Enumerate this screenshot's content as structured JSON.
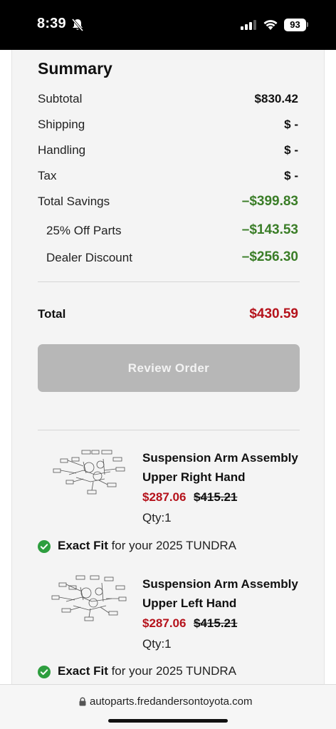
{
  "status_bar": {
    "time": "8:39",
    "battery": "93"
  },
  "summary": {
    "title": "Summary",
    "rows": [
      {
        "label": "Subtotal",
        "value": "$830.42"
      },
      {
        "label": "Shipping",
        "value": "$ -"
      },
      {
        "label": "Handling",
        "value": "$ -"
      },
      {
        "label": "Tax",
        "value": "$ -"
      },
      {
        "label": "Total Savings",
        "value": "–$399.83"
      },
      {
        "label": "25% Off Parts",
        "value": "–$143.53"
      },
      {
        "label": "Dealer Discount",
        "value": "–$256.30"
      }
    ],
    "total_label": "Total",
    "total_value": "$430.59",
    "review_button": "Review Order"
  },
  "items": [
    {
      "name_line1": "Suspension Arm Assembly",
      "name_line2": "Upper Right Hand",
      "price": "$287.06",
      "original_price": "$415.21",
      "qty": "Qty:1",
      "fit_strong": "Exact Fit",
      "fit_rest": " for your 2025 TUNDRA"
    },
    {
      "name_line1": "Suspension Arm Assembly",
      "name_line2": "Upper Left Hand",
      "price": "$287.06",
      "original_price": "$415.21",
      "qty": "Qty:1",
      "fit_strong": "Exact Fit",
      "fit_rest": " for your 2025 TUNDRA"
    }
  ],
  "browser": {
    "url": "autoparts.fredandersontoyota.com"
  },
  "colors": {
    "savings_green": "#3a7d27",
    "price_red": "#b5121b",
    "fit_check_green": "#2e9e3f",
    "button_disabled": "#b7b7b7"
  }
}
